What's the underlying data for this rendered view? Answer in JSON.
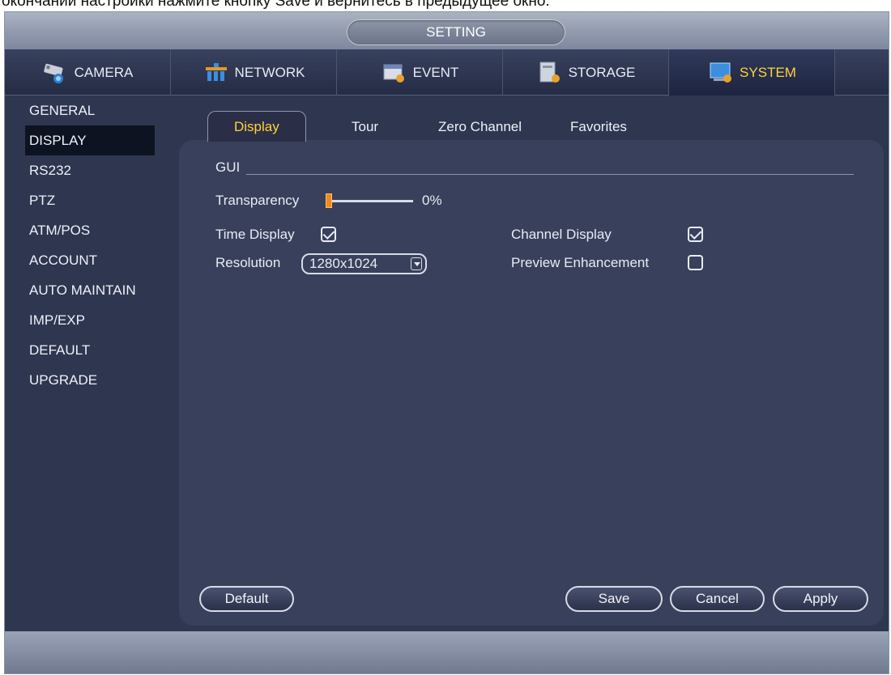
{
  "caption": "окончании настройки нажмите кнопку Save и вернитесь в предыдущее окно.",
  "window": {
    "title": "SETTING"
  },
  "mainnav": [
    {
      "label": "CAMERA",
      "icon": "camera-icon",
      "active": false
    },
    {
      "label": "NETWORK",
      "icon": "network-icon",
      "active": false
    },
    {
      "label": "EVENT",
      "icon": "event-icon",
      "active": false
    },
    {
      "label": "STORAGE",
      "icon": "storage-icon",
      "active": false
    },
    {
      "label": "SYSTEM",
      "icon": "system-icon",
      "active": true
    }
  ],
  "sidemenu": [
    {
      "label": "GENERAL"
    },
    {
      "label": "DISPLAY",
      "active": true
    },
    {
      "label": "RS232"
    },
    {
      "label": "PTZ"
    },
    {
      "label": "ATM/POS"
    },
    {
      "label": "ACCOUNT"
    },
    {
      "label": "AUTO MAINTAIN"
    },
    {
      "label": "IMP/EXP"
    },
    {
      "label": "DEFAULT"
    },
    {
      "label": "UPGRADE"
    }
  ],
  "subtabs": [
    {
      "label": "Display",
      "active": true
    },
    {
      "label": "Tour"
    },
    {
      "label": "Zero Channel"
    },
    {
      "label": "Favorites"
    }
  ],
  "gui": {
    "section_label": "GUI",
    "transparency_label": "Transparency",
    "transparency_value": "0%",
    "time_display_label": "Time Display",
    "time_display_checked": true,
    "channel_display_label": "Channel Display",
    "channel_display_checked": true,
    "resolution_label": "Resolution",
    "resolution_value": "1280x1024",
    "preview_enhancement_label": "Preview Enhancement",
    "preview_enhancement_checked": false
  },
  "buttons": {
    "default": "Default",
    "save": "Save",
    "cancel": "Cancel",
    "apply": "Apply"
  },
  "colors": {
    "accent": "#ffd23a",
    "slider": "#f08a1a",
    "panel": "#39405c",
    "background": "#2e3650"
  }
}
